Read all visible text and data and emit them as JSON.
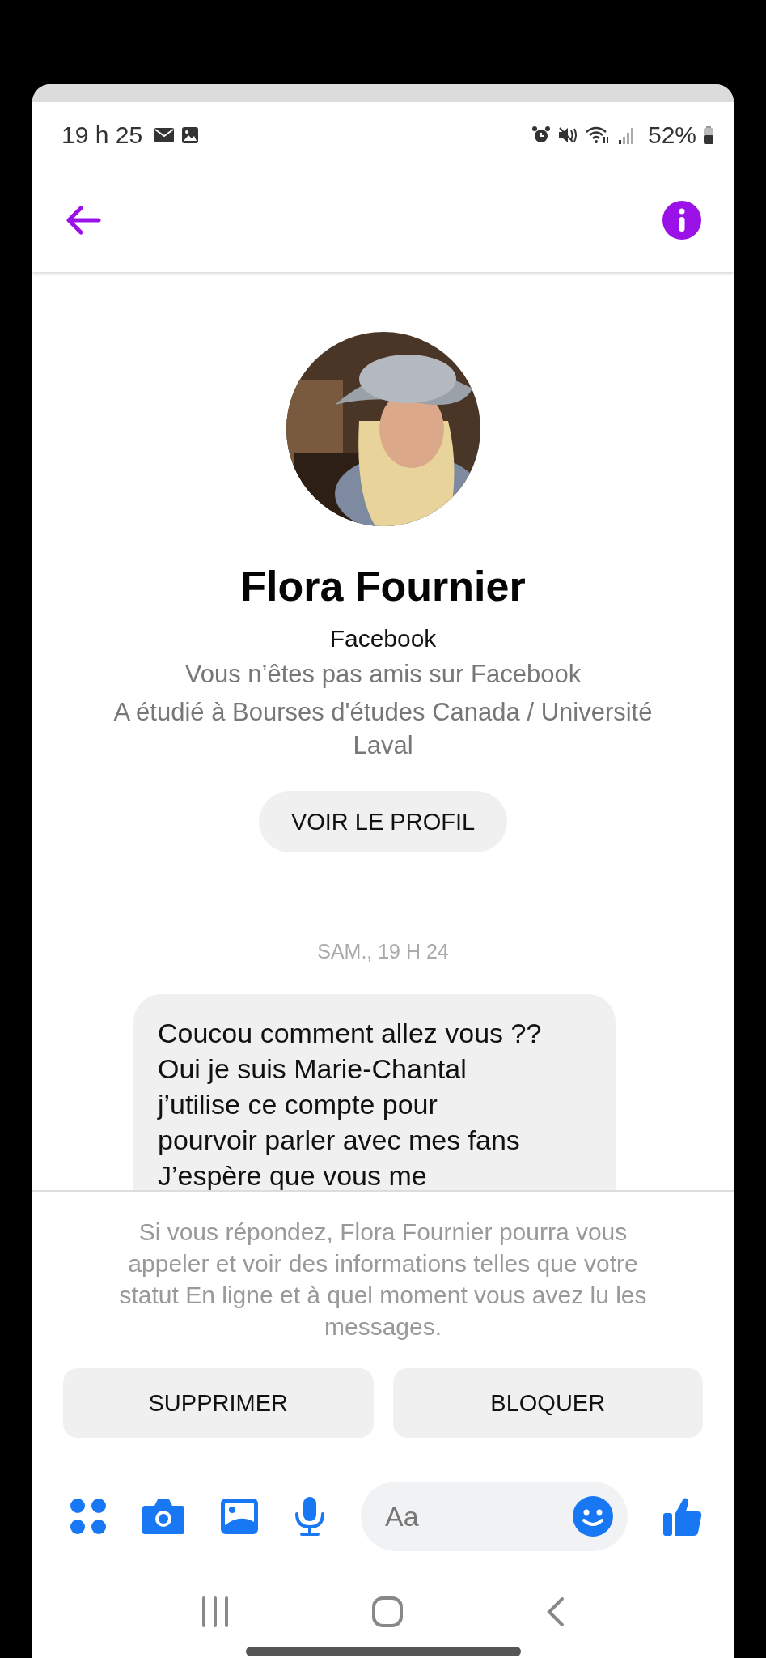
{
  "status_bar": {
    "time": "19 h 25",
    "battery": "52%"
  },
  "profile": {
    "name": "Flora Fournier",
    "platform": "Facebook",
    "details": [
      "Vous n’êtes pas amis sur Facebook",
      "A étudié à Bourses d'études Canada / Université Laval"
    ],
    "button": "VOIR LE PROFIL"
  },
  "conversation": {
    "timestamp": "SAM., 19 H 24",
    "messages": [
      {
        "lines": [
          "Coucou comment allez vous ??",
          "Oui je suis Marie-Chantal",
          "j’utilise ce compte pour",
          "pourvoir parler avec mes fans",
          "J’espère que vous me"
        ]
      }
    ]
  },
  "request_panel": {
    "notice": "Si vous répondez, Flora Fournier pourra vous appeler et voir des informations telles que votre statut En ligne et à quel moment vous avez lu les messages.",
    "buttons": [
      "SUPPRIMER",
      "BLOQUER"
    ]
  },
  "composer": {
    "placeholder": "Aa"
  }
}
